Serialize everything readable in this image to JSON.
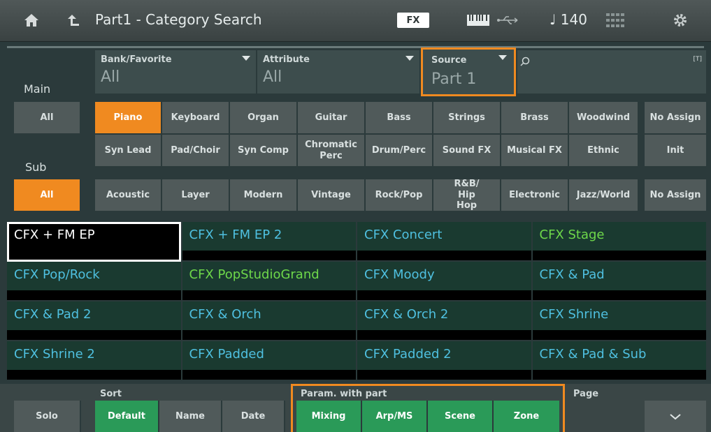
{
  "header": {
    "title": "Part1 - Category Search",
    "fx_label": "FX",
    "tempo": "♩ 140",
    "icons": [
      "home-icon",
      "back-icon",
      "keyboard-icon",
      "usb-icon",
      "grid-icon",
      "gear-icon"
    ]
  },
  "filters": {
    "bank_label": "Bank/Favorite",
    "bank_value": "All",
    "attribute_label": "Attribute",
    "attribute_value": "All",
    "source_label": "Source",
    "source_value": "Part 1",
    "search_tag": "[T]"
  },
  "main": {
    "row_label": "Main",
    "all_label": "All",
    "items": [
      "Piano",
      "Keyboard",
      "Organ",
      "Guitar",
      "Bass",
      "Strings",
      "Brass",
      "Woodwind"
    ],
    "no_assign": "No Assign",
    "items2": [
      "Syn Lead",
      "Pad/Choir",
      "Syn Comp",
      "Chromatic Perc",
      "Drum/Perc",
      "Sound FX",
      "Musical FX",
      "Ethnic"
    ],
    "init_label": "Init"
  },
  "sub": {
    "row_label": "Sub",
    "all_label": "All",
    "items": [
      "Acoustic",
      "Layer",
      "Modern",
      "Vintage",
      "Rock/Pop",
      "R&B/ Hip Hop",
      "Electronic",
      "Jazz/World"
    ],
    "no_assign": "No Assign"
  },
  "results": [
    {
      "name": "CFX + FM EP",
      "color": "#ffffff",
      "selected": true
    },
    {
      "name": "CFX + FM EP 2",
      "color": "#4fc0e0"
    },
    {
      "name": "CFX Concert",
      "color": "#4fc0e0"
    },
    {
      "name": "CFX Stage",
      "color": "#6ed84a"
    },
    {
      "name": "CFX Pop/Rock",
      "color": "#4fc0e0"
    },
    {
      "name": "CFX PopStudioGrand",
      "color": "#6ed84a"
    },
    {
      "name": "CFX Moody",
      "color": "#4fc0e0"
    },
    {
      "name": "CFX & Pad",
      "color": "#4fc0e0"
    },
    {
      "name": "CFX & Pad 2",
      "color": "#4fc0e0"
    },
    {
      "name": "CFX & Orch",
      "color": "#4fc0e0"
    },
    {
      "name": "CFX & Orch 2",
      "color": "#4fc0e0"
    },
    {
      "name": "CFX Shrine",
      "color": "#4fc0e0"
    },
    {
      "name": "CFX Shrine 2",
      "color": "#4fc0e0"
    },
    {
      "name": "CFX Padded",
      "color": "#4fc0e0"
    },
    {
      "name": "CFX Padded 2",
      "color": "#4fc0e0"
    },
    {
      "name": "CFX & Pad & Sub",
      "color": "#4fc0e0"
    }
  ],
  "bottom": {
    "solo_label": "Solo",
    "sort_label": "Sort",
    "sort_default": "Default",
    "sort_name": "Name",
    "sort_date": "Date",
    "param_label": "Param. with part",
    "param_mixing": "Mixing",
    "param_arp": "Arp/MS",
    "param_scene": "Scene",
    "param_zone": "Zone",
    "page_label": "Page"
  },
  "colors": {
    "accent": "#f08a20",
    "selected": "#2a9a58",
    "panel": "#505a5a"
  }
}
